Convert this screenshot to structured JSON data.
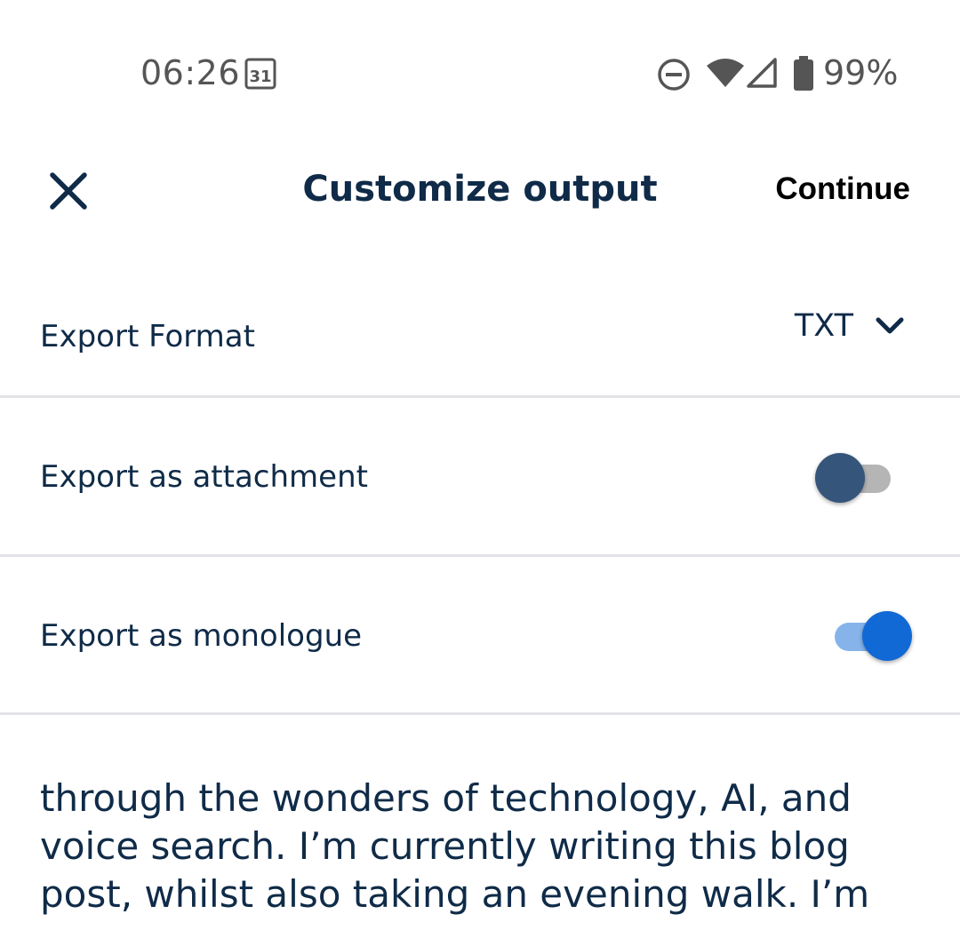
{
  "status_bar": {
    "time": "06:26",
    "calendar_day": "31",
    "battery": "99%",
    "icons": [
      "calendar-icon",
      "do-not-disturb-icon",
      "wifi-icon",
      "signal-icon",
      "battery-icon"
    ]
  },
  "header": {
    "title": "Customize output",
    "action": "Continue",
    "close_icon": "close-icon"
  },
  "settings": {
    "format_label": "Export Format",
    "format_value": "TXT",
    "attachment_label": "Export as attachment",
    "attachment_on": false,
    "monologue_label": "Export as monologue",
    "monologue_on": true
  },
  "preview": {
    "text": "through the wonders of technology, AI, and voice search. I’m currently writing this blog post, whilst also taking an evening walk. I’m"
  },
  "colors": {
    "primary_text": "#0f2b48",
    "switch_on": "#1169d6",
    "switch_off_thumb": "#35557a"
  }
}
